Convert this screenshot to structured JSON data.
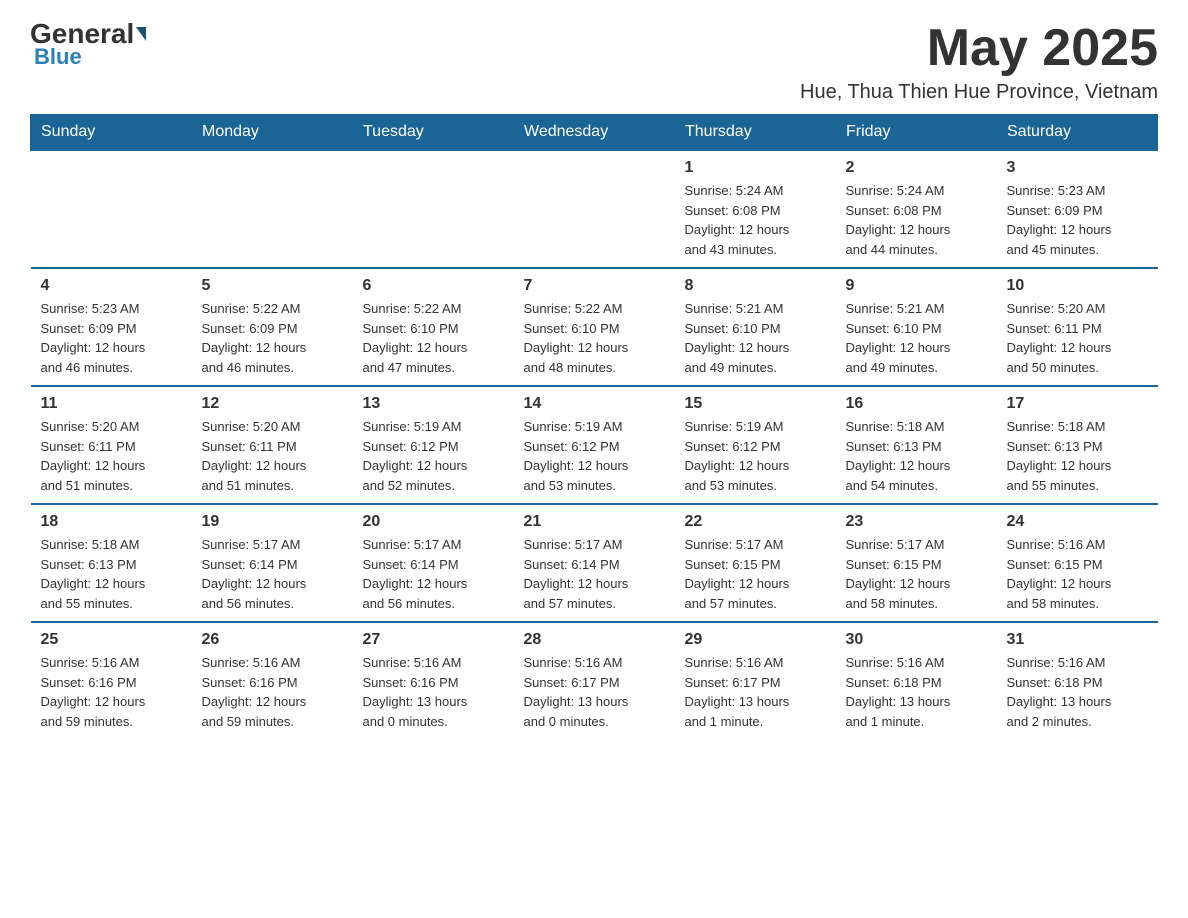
{
  "logo": {
    "general": "General",
    "blue": "Blue"
  },
  "header": {
    "month_year": "May 2025",
    "location": "Hue, Thua Thien Hue Province, Vietnam"
  },
  "days_of_week": [
    "Sunday",
    "Monday",
    "Tuesday",
    "Wednesday",
    "Thursday",
    "Friday",
    "Saturday"
  ],
  "weeks": [
    [
      {
        "day": "",
        "info": ""
      },
      {
        "day": "",
        "info": ""
      },
      {
        "day": "",
        "info": ""
      },
      {
        "day": "",
        "info": ""
      },
      {
        "day": "1",
        "info": "Sunrise: 5:24 AM\nSunset: 6:08 PM\nDaylight: 12 hours\nand 43 minutes."
      },
      {
        "day": "2",
        "info": "Sunrise: 5:24 AM\nSunset: 6:08 PM\nDaylight: 12 hours\nand 44 minutes."
      },
      {
        "day": "3",
        "info": "Sunrise: 5:23 AM\nSunset: 6:09 PM\nDaylight: 12 hours\nand 45 minutes."
      }
    ],
    [
      {
        "day": "4",
        "info": "Sunrise: 5:23 AM\nSunset: 6:09 PM\nDaylight: 12 hours\nand 46 minutes."
      },
      {
        "day": "5",
        "info": "Sunrise: 5:22 AM\nSunset: 6:09 PM\nDaylight: 12 hours\nand 46 minutes."
      },
      {
        "day": "6",
        "info": "Sunrise: 5:22 AM\nSunset: 6:10 PM\nDaylight: 12 hours\nand 47 minutes."
      },
      {
        "day": "7",
        "info": "Sunrise: 5:22 AM\nSunset: 6:10 PM\nDaylight: 12 hours\nand 48 minutes."
      },
      {
        "day": "8",
        "info": "Sunrise: 5:21 AM\nSunset: 6:10 PM\nDaylight: 12 hours\nand 49 minutes."
      },
      {
        "day": "9",
        "info": "Sunrise: 5:21 AM\nSunset: 6:10 PM\nDaylight: 12 hours\nand 49 minutes."
      },
      {
        "day": "10",
        "info": "Sunrise: 5:20 AM\nSunset: 6:11 PM\nDaylight: 12 hours\nand 50 minutes."
      }
    ],
    [
      {
        "day": "11",
        "info": "Sunrise: 5:20 AM\nSunset: 6:11 PM\nDaylight: 12 hours\nand 51 minutes."
      },
      {
        "day": "12",
        "info": "Sunrise: 5:20 AM\nSunset: 6:11 PM\nDaylight: 12 hours\nand 51 minutes."
      },
      {
        "day": "13",
        "info": "Sunrise: 5:19 AM\nSunset: 6:12 PM\nDaylight: 12 hours\nand 52 minutes."
      },
      {
        "day": "14",
        "info": "Sunrise: 5:19 AM\nSunset: 6:12 PM\nDaylight: 12 hours\nand 53 minutes."
      },
      {
        "day": "15",
        "info": "Sunrise: 5:19 AM\nSunset: 6:12 PM\nDaylight: 12 hours\nand 53 minutes."
      },
      {
        "day": "16",
        "info": "Sunrise: 5:18 AM\nSunset: 6:13 PM\nDaylight: 12 hours\nand 54 minutes."
      },
      {
        "day": "17",
        "info": "Sunrise: 5:18 AM\nSunset: 6:13 PM\nDaylight: 12 hours\nand 55 minutes."
      }
    ],
    [
      {
        "day": "18",
        "info": "Sunrise: 5:18 AM\nSunset: 6:13 PM\nDaylight: 12 hours\nand 55 minutes."
      },
      {
        "day": "19",
        "info": "Sunrise: 5:17 AM\nSunset: 6:14 PM\nDaylight: 12 hours\nand 56 minutes."
      },
      {
        "day": "20",
        "info": "Sunrise: 5:17 AM\nSunset: 6:14 PM\nDaylight: 12 hours\nand 56 minutes."
      },
      {
        "day": "21",
        "info": "Sunrise: 5:17 AM\nSunset: 6:14 PM\nDaylight: 12 hours\nand 57 minutes."
      },
      {
        "day": "22",
        "info": "Sunrise: 5:17 AM\nSunset: 6:15 PM\nDaylight: 12 hours\nand 57 minutes."
      },
      {
        "day": "23",
        "info": "Sunrise: 5:17 AM\nSunset: 6:15 PM\nDaylight: 12 hours\nand 58 minutes."
      },
      {
        "day": "24",
        "info": "Sunrise: 5:16 AM\nSunset: 6:15 PM\nDaylight: 12 hours\nand 58 minutes."
      }
    ],
    [
      {
        "day": "25",
        "info": "Sunrise: 5:16 AM\nSunset: 6:16 PM\nDaylight: 12 hours\nand 59 minutes."
      },
      {
        "day": "26",
        "info": "Sunrise: 5:16 AM\nSunset: 6:16 PM\nDaylight: 12 hours\nand 59 minutes."
      },
      {
        "day": "27",
        "info": "Sunrise: 5:16 AM\nSunset: 6:16 PM\nDaylight: 13 hours\nand 0 minutes."
      },
      {
        "day": "28",
        "info": "Sunrise: 5:16 AM\nSunset: 6:17 PM\nDaylight: 13 hours\nand 0 minutes."
      },
      {
        "day": "29",
        "info": "Sunrise: 5:16 AM\nSunset: 6:17 PM\nDaylight: 13 hours\nand 1 minute."
      },
      {
        "day": "30",
        "info": "Sunrise: 5:16 AM\nSunset: 6:18 PM\nDaylight: 13 hours\nand 1 minute."
      },
      {
        "day": "31",
        "info": "Sunrise: 5:16 AM\nSunset: 6:18 PM\nDaylight: 13 hours\nand 2 minutes."
      }
    ]
  ]
}
